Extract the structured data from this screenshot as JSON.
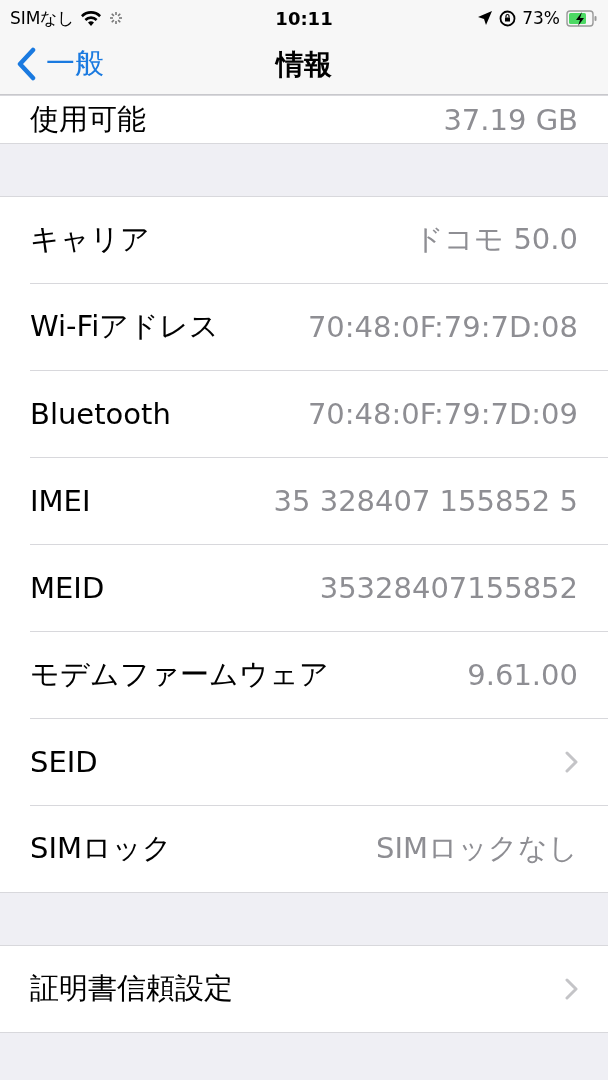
{
  "status_bar": {
    "carrier": "SIMなし",
    "time": "10:11",
    "battery_percent": "73%"
  },
  "nav_bar": {
    "back_label": "一般",
    "title": "情報"
  },
  "sections": [
    {
      "rows": [
        {
          "kind": "value",
          "label": "使用可能",
          "value": "37.19 GB"
        }
      ]
    },
    {
      "rows": [
        {
          "kind": "value",
          "label": "キャリア",
          "value": "ドコモ 50.0"
        },
        {
          "kind": "value",
          "label": "Wi-Fiアドレス",
          "value": "70:48:0F:79:7D:08"
        },
        {
          "kind": "value",
          "label": "Bluetooth",
          "value": "70:48:0F:79:7D:09"
        },
        {
          "kind": "value",
          "label": "IMEI",
          "value": "35 328407 155852 5"
        },
        {
          "kind": "value",
          "label": "MEID",
          "value": "35328407155852"
        },
        {
          "kind": "value",
          "label": "モデムファームウェア",
          "value": "9.61.00"
        },
        {
          "kind": "link",
          "label": "SEID"
        },
        {
          "kind": "value",
          "label": "SIMロック",
          "value": "SIMロックなし"
        }
      ]
    },
    {
      "rows": [
        {
          "kind": "link",
          "label": "証明書信頼設定"
        }
      ]
    }
  ]
}
